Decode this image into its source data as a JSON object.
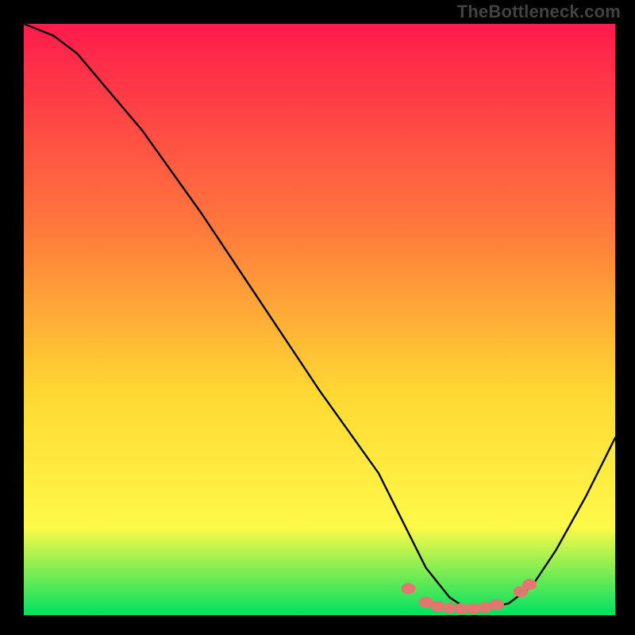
{
  "watermark": "TheBottleneck.com",
  "chart_data": {
    "type": "line",
    "title": "",
    "xlabel": "",
    "ylabel": "",
    "xlim": [
      0,
      100
    ],
    "ylim": [
      0,
      100
    ],
    "background_gradient": [
      "#ff1b4c",
      "#ff7a3c",
      "#ffd733",
      "#fff948",
      "#00e060"
    ],
    "series": [
      {
        "name": "bottleneck-curve",
        "x": [
          0,
          5,
          9,
          20,
          30,
          40,
          50,
          60,
          64,
          68,
          72,
          75,
          78,
          82,
          86,
          90,
          95,
          100
        ],
        "values": [
          100,
          98,
          95,
          82,
          68,
          53,
          38,
          24,
          16,
          8,
          3,
          1,
          1,
          2,
          5,
          11,
          20,
          30
        ]
      }
    ],
    "markers": {
      "name": "optimal-range",
      "color": "#e1776e",
      "points": [
        {
          "x": 65,
          "y": 4.5
        },
        {
          "x": 68,
          "y": 2.2
        },
        {
          "x": 70,
          "y": 1.5
        },
        {
          "x": 72,
          "y": 1.2
        },
        {
          "x": 74,
          "y": 1.1
        },
        {
          "x": 76,
          "y": 1.1
        },
        {
          "x": 78,
          "y": 1.3
        },
        {
          "x": 80,
          "y": 1.8
        },
        {
          "x": 84,
          "y": 4.0
        },
        {
          "x": 85.5,
          "y": 5.2
        }
      ]
    }
  }
}
